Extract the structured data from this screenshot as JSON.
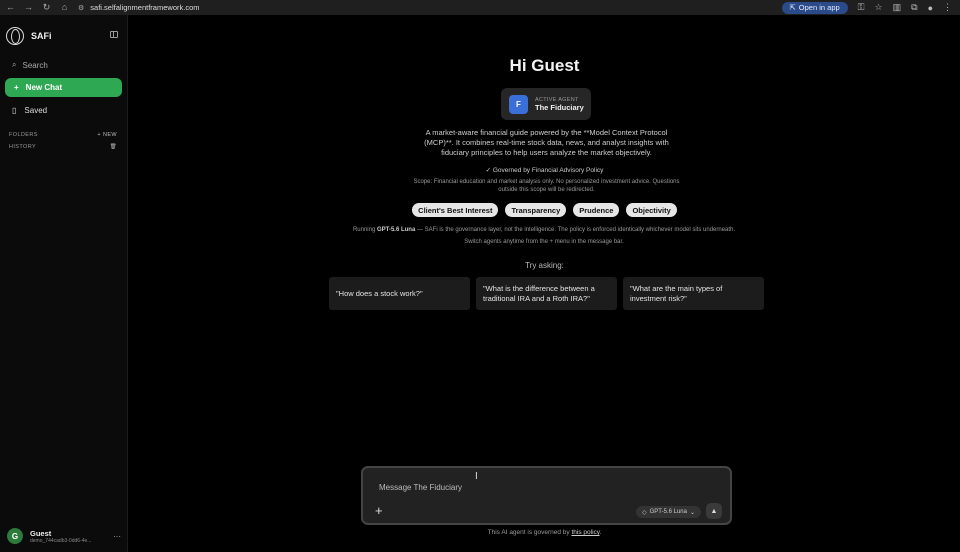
{
  "browser": {
    "url": "safi.selfalignmentframework.com",
    "open_in_app": "Open in app"
  },
  "sidebar": {
    "app_name": "SAFi",
    "search_label": "Search",
    "new_chat_label": "New Chat",
    "saved_label": "Saved",
    "folders_label": "FOLDERS",
    "new_folder_label": "+ NEW",
    "history_label": "HISTORY",
    "user": {
      "initial": "G",
      "name": "Guest",
      "id": "demo_744cadb3-0dd6-4e..."
    }
  },
  "main": {
    "greeting": "Hi Guest",
    "agent": {
      "initial": "F",
      "label": "ACTIVE AGENT",
      "name": "The Fiduciary"
    },
    "description": "A market-aware financial guide powered by the **Model Context Protocol (MCP)**. It combines real-time stock data, news, and analyst insights with fiduciary principles to help users analyze the market objectively.",
    "governed_by": "Governed by Financial Advisory Policy",
    "scope": "Scope: Financial education and market analysis only. No personalized investment advice. Questions outside this scope will be redirected.",
    "values": [
      "Client's Best Interest",
      "Transparency",
      "Prudence",
      "Objectivity"
    ],
    "running": {
      "prefix": "Running",
      "model": "GPT-5.6 Luna",
      "line1_rest": "— SAFi is the governance layer, not the intelligence. The policy is enforced identically whichever model sits underneath.",
      "line2": "Switch agents anytime from the + menu in the message bar."
    },
    "try_asking": "Try asking:",
    "suggestions": [
      "\"How does a stock work?\"",
      "\"What is the difference between a traditional IRA and a Roth IRA?\"",
      "\"What are the main types of investment risk?\""
    ],
    "composer": {
      "placeholder": "Message The Fiduciary",
      "model_label": "GPT-5.6 Luna"
    },
    "footer": {
      "text": "This AI agent is governed by",
      "link": "this policy",
      "end": "."
    }
  }
}
